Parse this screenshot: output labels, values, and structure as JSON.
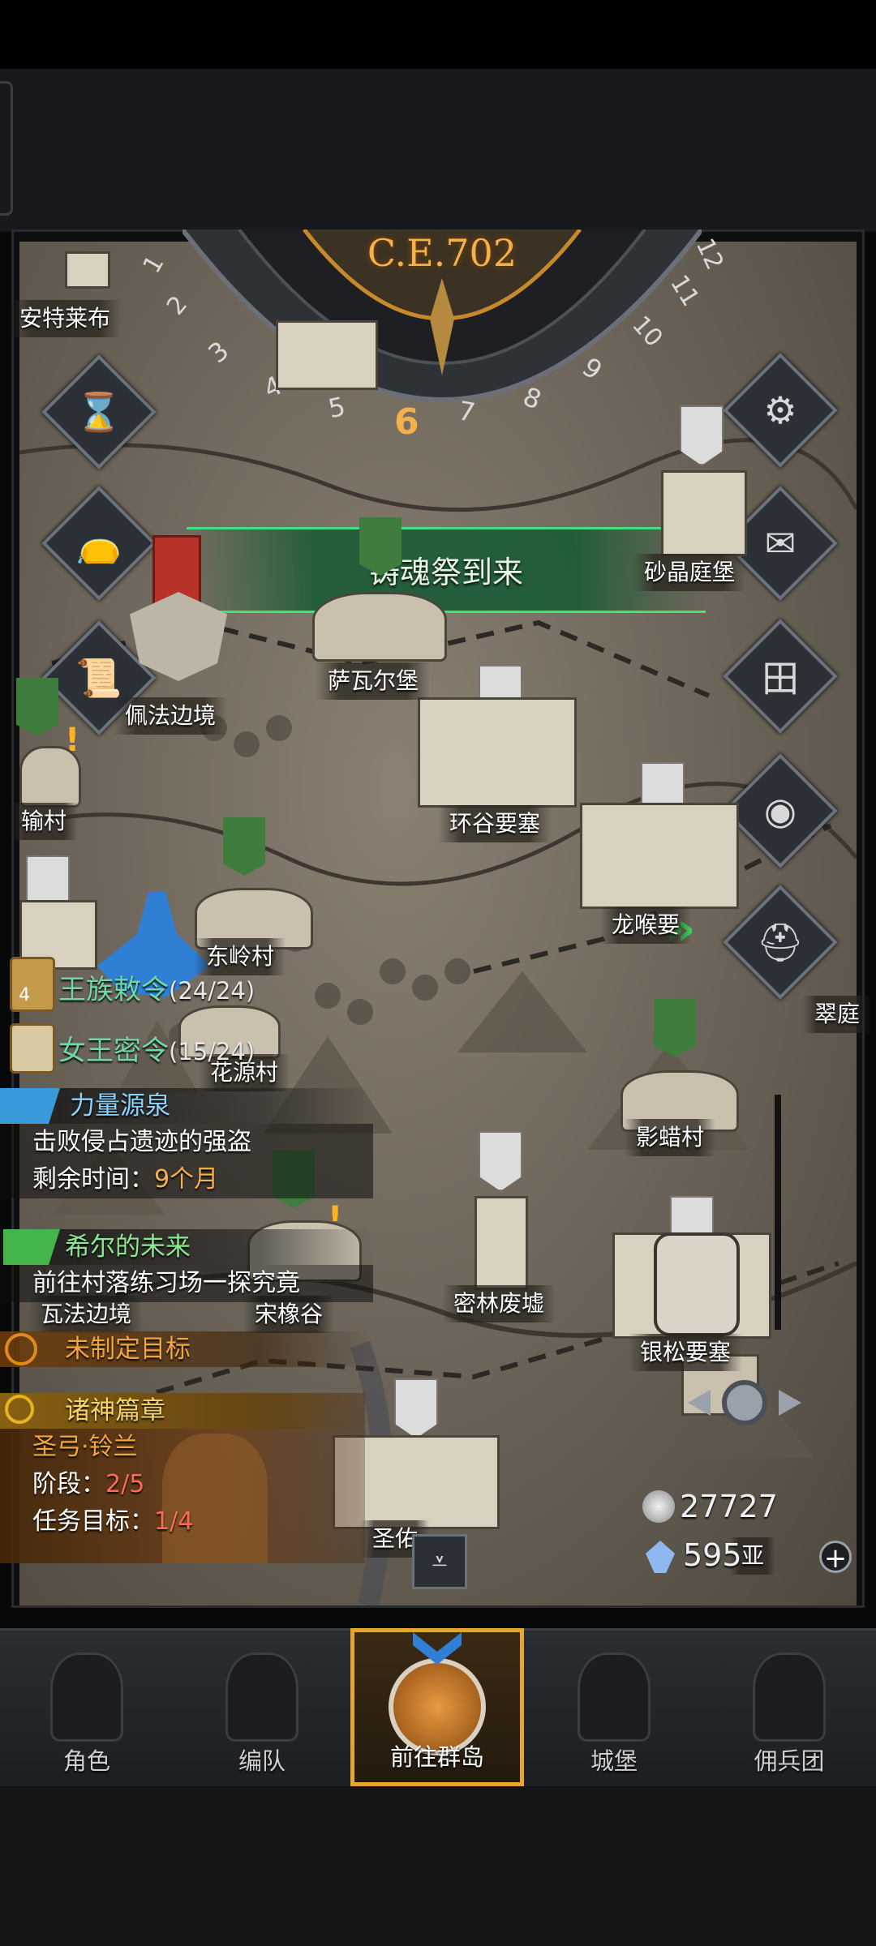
{
  "calendar": {
    "year": "C.E.702",
    "months": [
      "1",
      "2",
      "3",
      "4",
      "5",
      "6",
      "7",
      "8",
      "9",
      "10",
      "11",
      "12"
    ],
    "current_month": "6"
  },
  "event_banner": "铸魂祭到来",
  "locations": {
    "l1": "安特莱布",
    "l2": "砂晶庭堡",
    "l3": "萨瓦尔堡",
    "l4": "佩法边境",
    "l5": "环谷要塞",
    "l6": "输村",
    "l7": "龙喉要",
    "l8": "东岭村",
    "l9": "翠庭",
    "l10": "花源村",
    "l11": "影蜡村",
    "l12": "密林废墟",
    "l13": "银松要塞",
    "l14": "瓦法边境",
    "l15": "宋橡谷",
    "l16": "圣佑",
    "l17": "亚"
  },
  "orders": [
    {
      "name": "王族敕令",
      "count": "(24/24)",
      "badge": "4"
    },
    {
      "name": "女王密令",
      "count": "(15/24)"
    }
  ],
  "quests": {
    "q1": {
      "title": "力量源泉",
      "desc": "击败侵占遗迹的强盗",
      "time_label": "剩余时间：",
      "time_value": "9个月"
    },
    "q2": {
      "title": "希尔的未来",
      "desc": "前往村落练习场一探究竟"
    },
    "q3": {
      "title": "未制定目标"
    },
    "q4": {
      "title": "诸神篇章",
      "hero": "圣弓·铃兰",
      "stage_label": "阶段：",
      "stage_value": "2/5",
      "goal_label": "任务目标：",
      "goal_value": "1/4"
    }
  },
  "resources": {
    "silver": "27727",
    "crystal": "595"
  },
  "nav": [
    {
      "label": "角色",
      "icon": "knight-icon"
    },
    {
      "label": "编队",
      "icon": "formation-icon"
    },
    {
      "label": "前往群岛",
      "icon": "islands-icon",
      "active": true
    },
    {
      "label": "城堡",
      "icon": "castle-icon"
    },
    {
      "label": "佣兵团",
      "icon": "mercenary-icon"
    }
  ],
  "colors": {
    "accent_gold": "#f3b04b",
    "event_green": "#46e07a",
    "quest_blue": "#3a9ad9",
    "quest_green": "#43b54a",
    "quest_orange": "#e08a1e",
    "quest_gold": "#e6b422",
    "active_nav_border": "#e6a531"
  }
}
